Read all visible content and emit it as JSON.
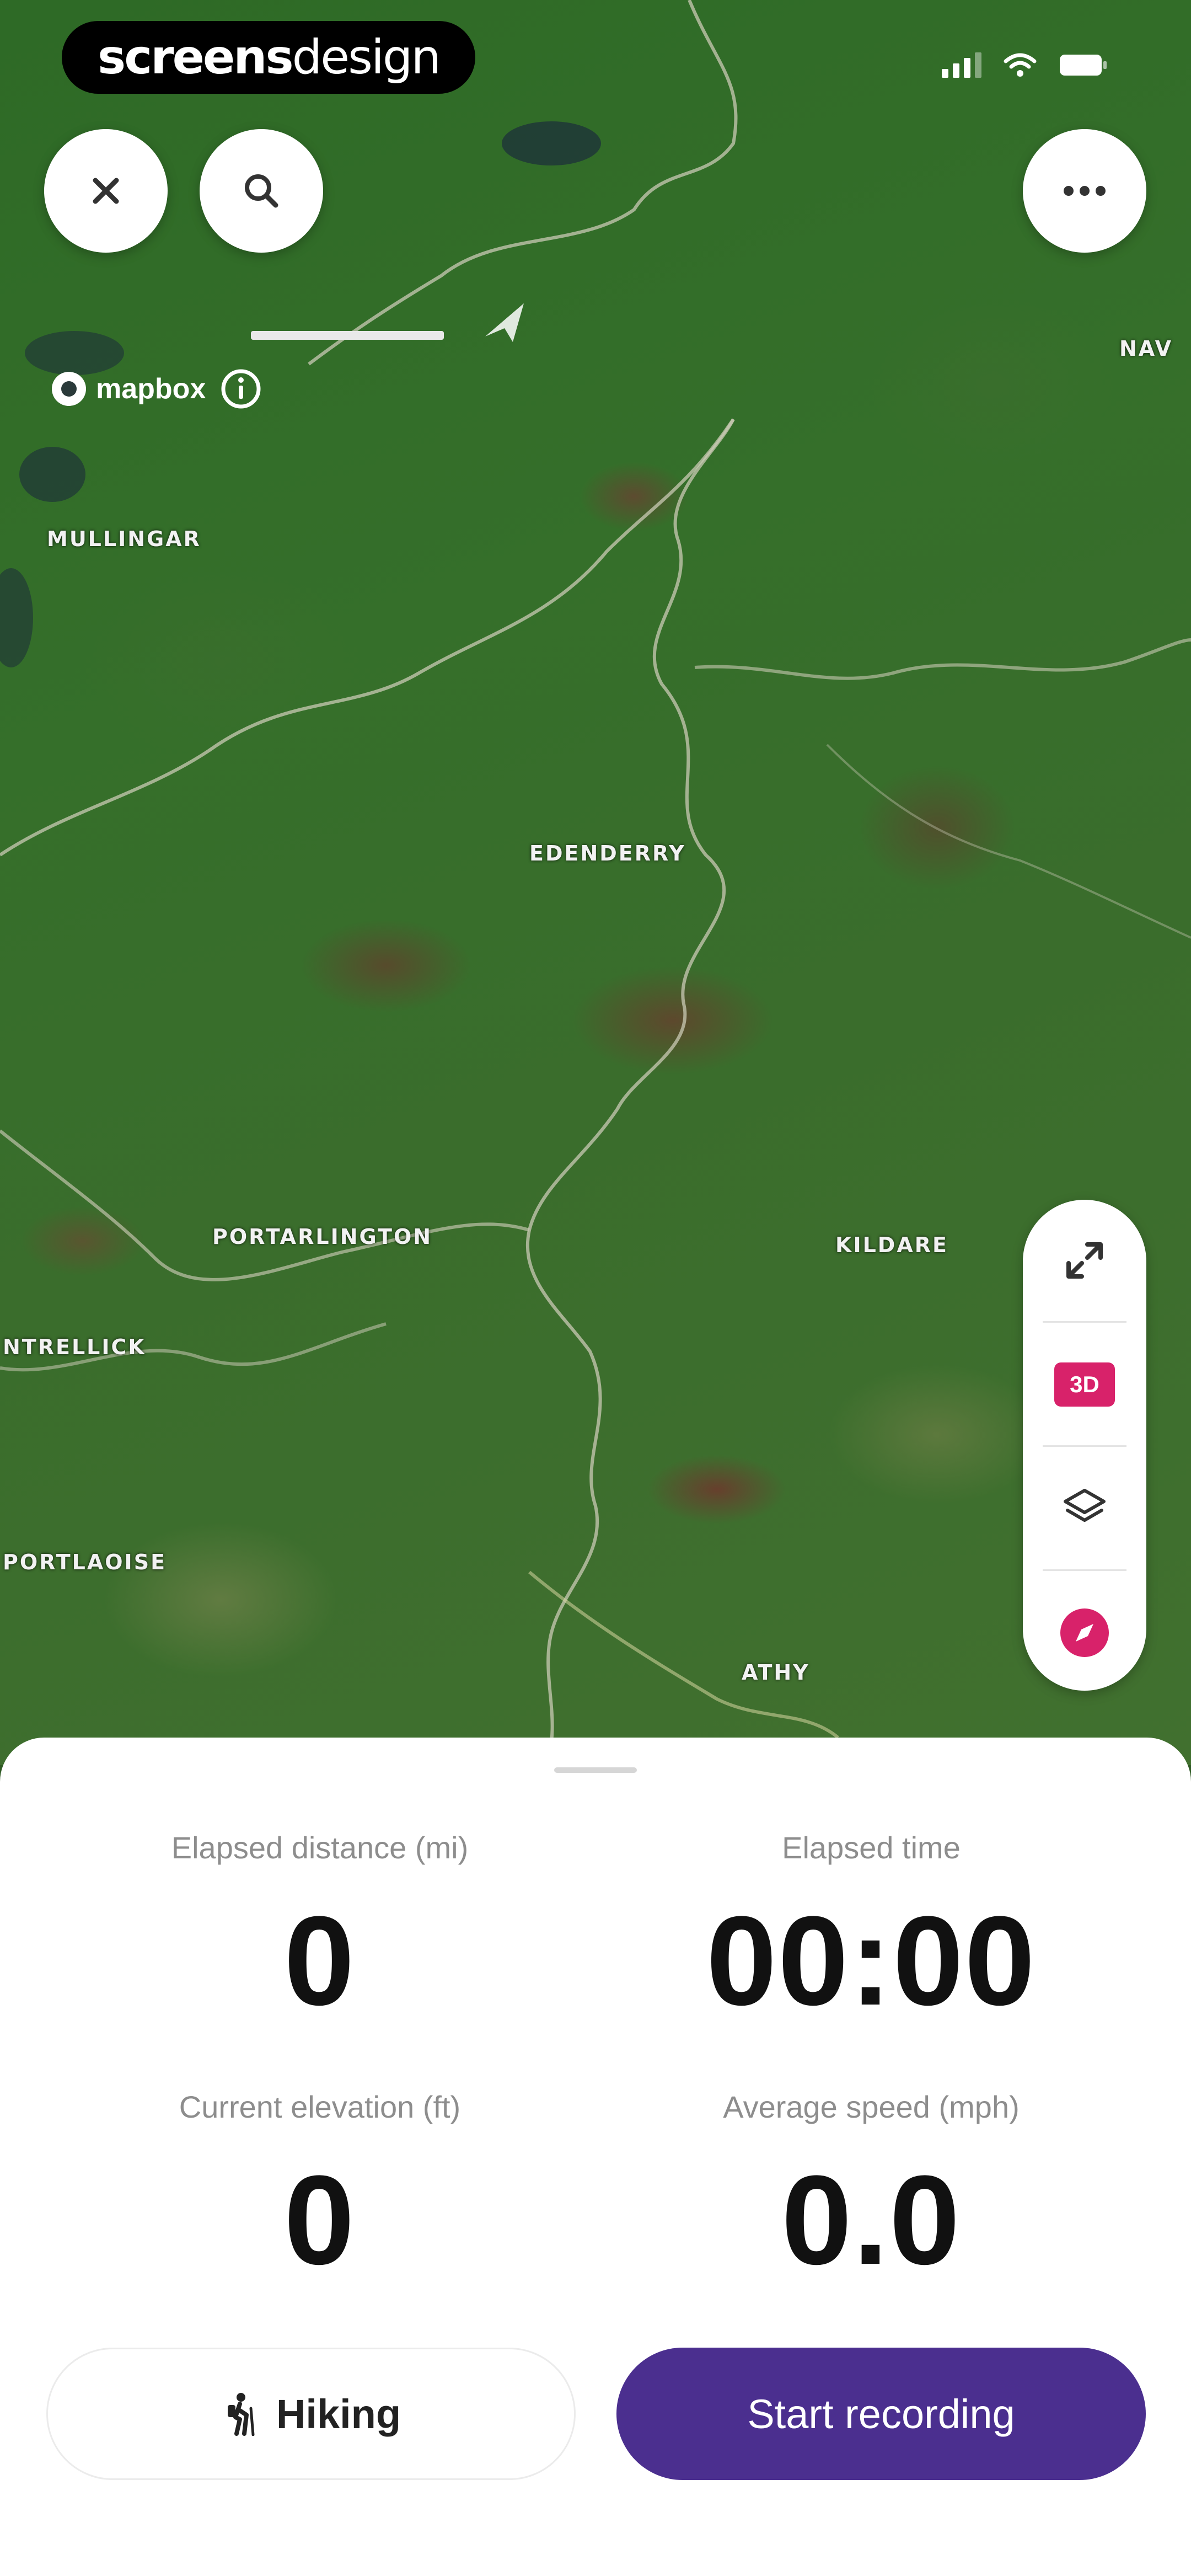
{
  "brand": {
    "part1": "screens",
    "part2": "design"
  },
  "map": {
    "attribution": "mapbox",
    "labels": [
      "MULLINGAR",
      "EDENDERRY",
      "PORTARLINGTON",
      "KILDARE",
      "NTRELLICK",
      "PORTLAOISE",
      "ATHY",
      "NAV"
    ]
  },
  "map_controls": {
    "three_d_label": "3D"
  },
  "stats": {
    "distance": {
      "label": "Elapsed distance (mi)",
      "value": "0"
    },
    "time": {
      "label": "Elapsed time",
      "value": "00:00"
    },
    "elevation": {
      "label": "Current elevation (ft)",
      "value": "0"
    },
    "speed": {
      "label": "Average speed (mph)",
      "value": "0.0"
    }
  },
  "actions": {
    "activity_label": "Hiking",
    "start_label": "Start recording"
  },
  "colors": {
    "accent": "#4b2f8f",
    "badge": "#d8226a"
  },
  "icons": {
    "close": "close-icon",
    "search": "search-icon",
    "more": "more-icon",
    "expand": "expand-icon",
    "layers": "layers-icon",
    "compass": "compass-icon",
    "hiker": "hiker-icon",
    "info": "info-icon"
  }
}
